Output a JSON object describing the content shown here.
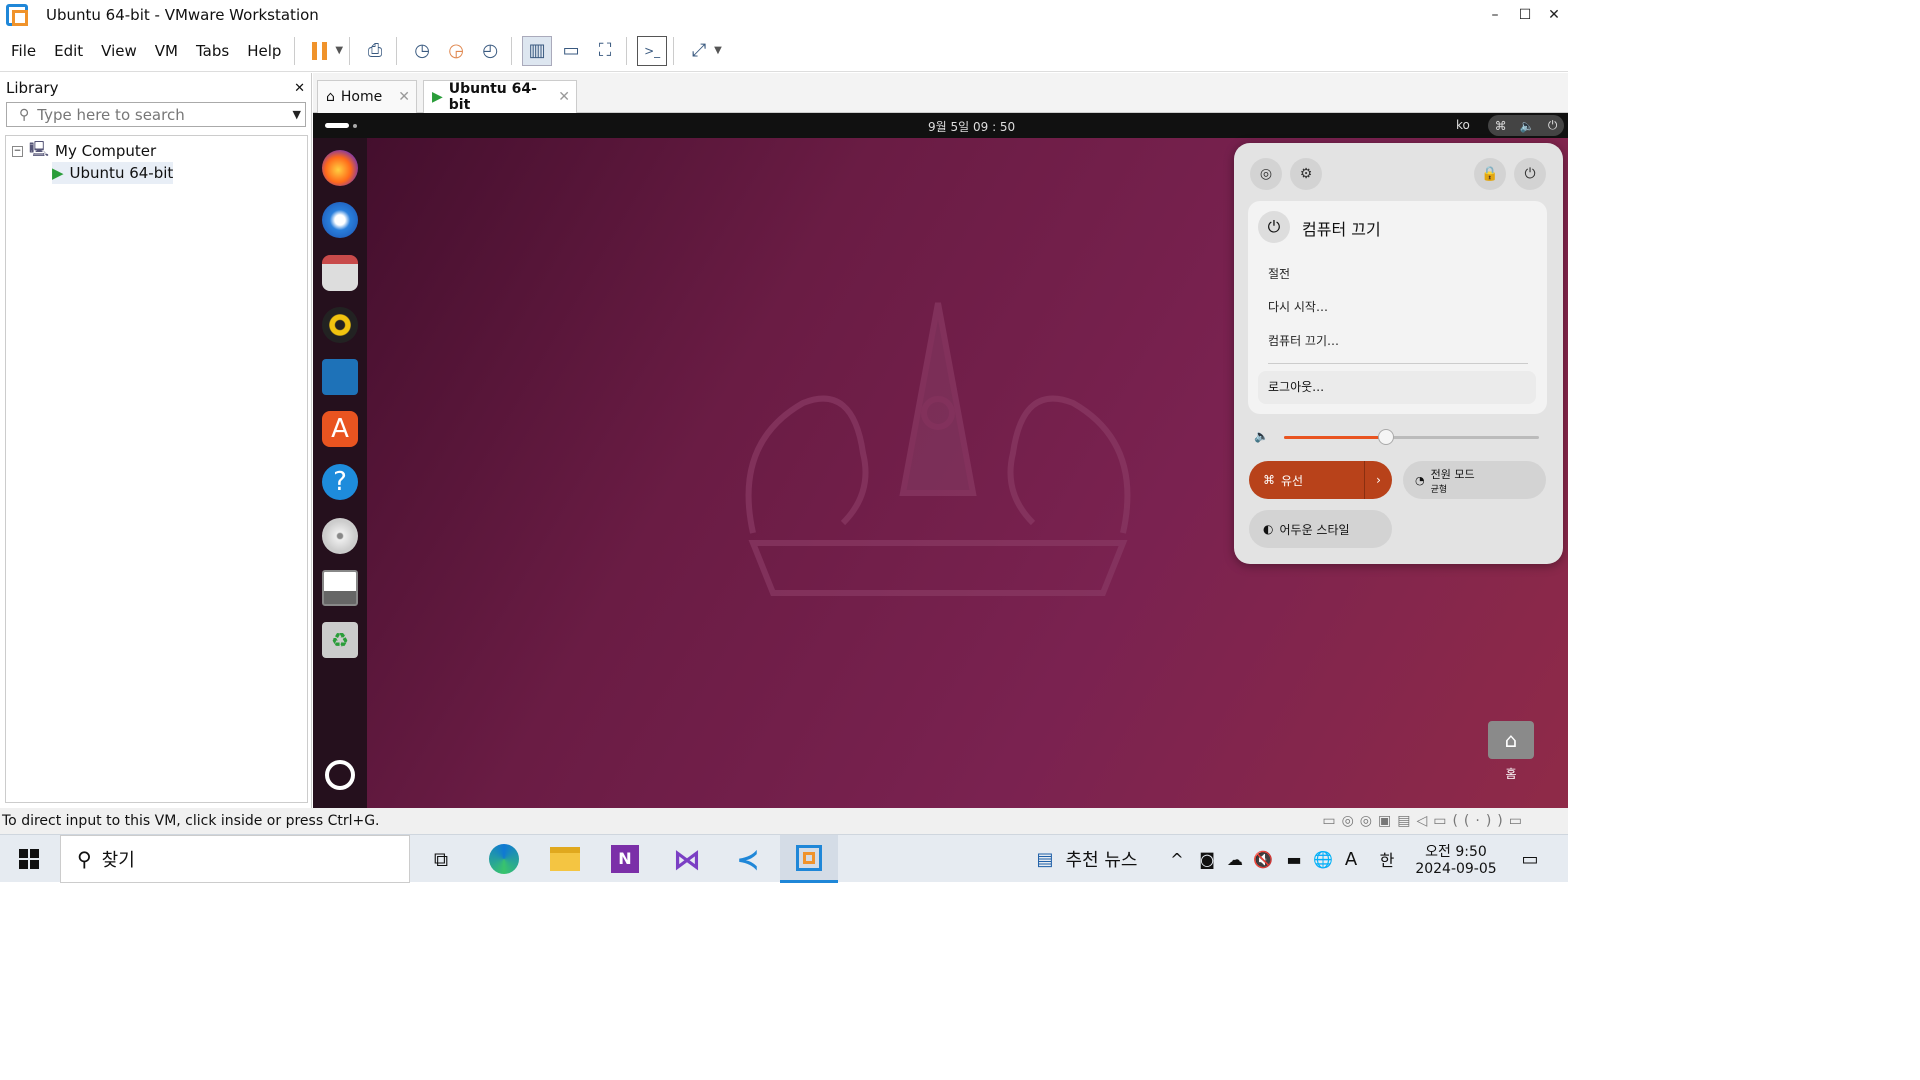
{
  "window": {
    "title": "Ubuntu 64-bit - VMware Workstation",
    "min": "–",
    "max": "☐",
    "close": "✕"
  },
  "menu": [
    "File",
    "Edit",
    "View",
    "VM",
    "Tabs",
    "Help"
  ],
  "toolbar_icons": [
    "pause-icon",
    "send-keys-icon",
    "snapshot-icon",
    "revert-snapshot-icon",
    "snapshot-manager-icon",
    "library-view-icon",
    "thumbnail-view-icon",
    "fullscreen-icon",
    "console-icon",
    "stretch-icon"
  ],
  "library": {
    "title": "Library",
    "close": "✕",
    "search_placeholder": "Type here to search",
    "root": "My Computer",
    "vm": "Ubuntu 64-bit"
  },
  "tabs": [
    {
      "label": "Home"
    },
    {
      "label": "Ubuntu 64-bit"
    }
  ],
  "ubuntu": {
    "clock": "9월 5일 09 : 50",
    "lang": "ko",
    "power_menu": {
      "title": "컴퓨터 끄기",
      "items": [
        "절전",
        "다시 시작…",
        "컴퓨터 끄기…"
      ],
      "logout": "로그아웃…"
    },
    "volume_level": 0.4,
    "wired": "유선",
    "power_mode": {
      "title": "전원 모드",
      "sub": "균형"
    },
    "dark_style": "어두운 스타일",
    "home_label": "홈"
  },
  "statusbar": {
    "text": "To direct input to this VM, click inside or press Ctrl+G."
  },
  "taskbar": {
    "search": "찾기",
    "news": "추천 뉴스",
    "time": "오전 9:50",
    "date": "2024-09-05",
    "ime": "한",
    "ime2": "A"
  },
  "colors": {
    "accent_orange": "#e95420",
    "wired_bg": "#b8421a"
  }
}
